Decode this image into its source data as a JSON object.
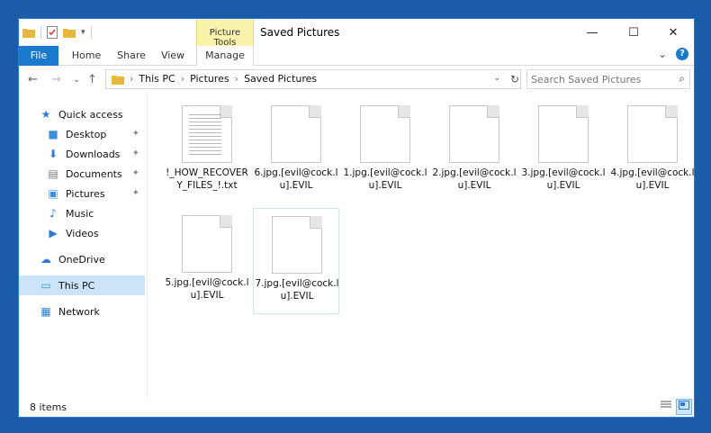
{
  "window": {
    "title": "Saved Pictures",
    "context_tab": "Picture Tools",
    "minimize": "—",
    "maximize": "☐",
    "close": "✕"
  },
  "ribbon": {
    "tabs": [
      "File",
      "Home",
      "Share",
      "View",
      "Manage"
    ],
    "expand": "⌄",
    "help": "?"
  },
  "address": {
    "back": "←",
    "forward": "→",
    "recent": "⌄",
    "up": "↑",
    "crumbs": [
      "This PC",
      "Pictures",
      "Saved Pictures"
    ],
    "separator": "›",
    "dropdown": "⌄",
    "refresh": "↻"
  },
  "search": {
    "placeholder": "Search Saved Pictures",
    "icon": "⌕"
  },
  "sidebar": {
    "items": [
      {
        "label": "Quick access",
        "icon": "★",
        "color": "#2b7bd6"
      },
      {
        "label": "Desktop",
        "icon": "■",
        "color": "#3a8fe0"
      },
      {
        "label": "Downloads",
        "icon": "⬇",
        "color": "#2b7bd6"
      },
      {
        "label": "Documents",
        "icon": "▤",
        "color": "#7a7a7a"
      },
      {
        "label": "Pictures",
        "icon": "▣",
        "color": "#3a8fe0"
      },
      {
        "label": "Music",
        "icon": "♪",
        "color": "#2b7bd6"
      },
      {
        "label": "Videos",
        "icon": "▶",
        "color": "#2b7bd6"
      },
      {
        "label": "OneDrive",
        "icon": "☁",
        "color": "#2b7bd6"
      },
      {
        "label": "This PC",
        "icon": "▭",
        "color": "#3a8fe0"
      },
      {
        "label": "Network",
        "icon": "▦",
        "color": "#2b7bd6"
      }
    ],
    "pin_icon": "📌"
  },
  "files": [
    {
      "label": "!_HOW_RECOVERY_FILES_!.txt",
      "type": "text"
    },
    {
      "label": "6.jpg.[evil@cock.lu].EVIL",
      "type": "blank"
    },
    {
      "label": "1.jpg.[evil@cock.lu].EVIL",
      "type": "blank"
    },
    {
      "label": "2.jpg.[evil@cock.lu].EVIL",
      "type": "blank"
    },
    {
      "label": "3.jpg.[evil@cock.lu].EVIL",
      "type": "blank"
    },
    {
      "label": "4.jpg.[evil@cock.lu].EVIL",
      "type": "blank"
    },
    {
      "label": "5.jpg.[evil@cock.lu].EVIL",
      "type": "blank"
    },
    {
      "label": "7.jpg.[evil@cock.lu].EVIL",
      "type": "blank"
    }
  ],
  "status": {
    "count": "8 items"
  },
  "colors": {
    "accent": "#1979ca",
    "context_tab": "#fbf3ac",
    "selection": "#cce4f7"
  }
}
